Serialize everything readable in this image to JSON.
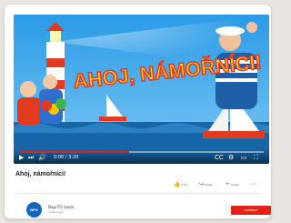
{
  "video": {
    "title_text": "AHOJ, NÁMOŘNÍCI!",
    "time": "0:00 / 3:20",
    "progress": 0.45
  },
  "page": {
    "title": "Ahoj, námořníci!"
  },
  "actions": [
    {
      "icon": "thumbs-up-icon",
      "label": "1 tis."
    },
    {
      "icon": "share-icon",
      "label": "Sdílet"
    },
    {
      "icon": "add-icon",
      "label": "Uložit"
    },
    {
      "icon": "more-icon",
      "label": "..."
    }
  ],
  "channel": {
    "avatar_text": "NPG",
    "name": "NapriTV kanál",
    "subs": "odběratelé",
    "subscribe_label": "ODEBÍRAT"
  },
  "colors": {
    "accent": "#e62117",
    "sky": "#1e88d8",
    "sea": "#1767a8",
    "title_yellow": "#ffd12e",
    "title_red": "#e23b22"
  }
}
